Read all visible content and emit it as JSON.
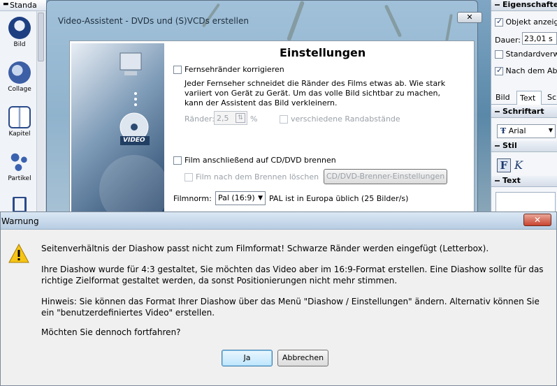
{
  "left_toolbar": {
    "header": "Standa",
    "items": [
      {
        "label": "Bild",
        "icon": "image-icon"
      },
      {
        "label": "Collage",
        "icon": "collage-icon"
      },
      {
        "label": "Kapitel",
        "icon": "chapter-icon"
      },
      {
        "label": "Partikel",
        "icon": "particle-icon"
      }
    ]
  },
  "right_panel": {
    "header": "Eigenschaften",
    "show_object_label": "Objekt anzeigen",
    "duration_label": "Dauer:",
    "duration_value": "23,01 s",
    "standard_label": "Standardverwe",
    "after_label": "Nach dem Abspi",
    "tabs": [
      "Bild",
      "Text",
      "Sc"
    ],
    "font_section": "Schriftart",
    "font_value": "Arial",
    "style_section": "Stil",
    "text_section": "Text"
  },
  "video_dialog": {
    "title": "Video-Assistent - DVDs und (S)VCDs erstellen",
    "close_label": "✕",
    "banner_label": "VIDEO",
    "section_title": "Einstellungen",
    "tv_borders_label": "Fernsehränder korrigieren",
    "tv_borders_desc": "Jeder Fernseher schneidet die Ränder des Films etwas ab. Wie stark variiert von Gerät zu Gerät. Um das volle Bild sichtbar zu machen, kann der Assistent das Bild verkleinern.",
    "margins_label": "Ränder:",
    "margins_value": "2,5",
    "margins_unit": "%",
    "various_margins_label": "verschiedene Randabstände",
    "burn_label": "Film anschließend auf CD/DVD brennen",
    "delete_after_burn_label": "Film nach dem Brennen löschen",
    "burner_settings_button": "CD/DVD-Brenner-Einstellungen",
    "film_norm_label": "Filmnorm:",
    "film_norm_value": "Pal (16:9)",
    "film_norm_hint": "PAL ist in Europa üblich (25 Bilder/s)"
  },
  "warning_dialog": {
    "title": "Warnung",
    "close_label": "✕",
    "message_1": "Seitenverhältnis der Diashow passt nicht zum Filmformat! Schwarze Ränder werden eingefügt (Letterbox).",
    "message_2": "Ihre Diashow wurde für 4:3 gestaltet, Sie möchten das Video aber im 16:9-Format erstellen. Eine Diashow sollte für das richtige Zielformat gestaltet werden, da sonst Positionierungen nicht mehr stimmen.",
    "message_3": "Hinweis: Sie können das Format Ihrer Diashow über das Menü \"Diashow / Einstellungen\" ändern. Alternativ können Sie ein \"benutzerdefiniertes Video\" erstellen.",
    "message_4": "Möchten Sie dennoch fortfahren?",
    "yes_button": "Ja",
    "cancel_button": "Abbrechen"
  }
}
